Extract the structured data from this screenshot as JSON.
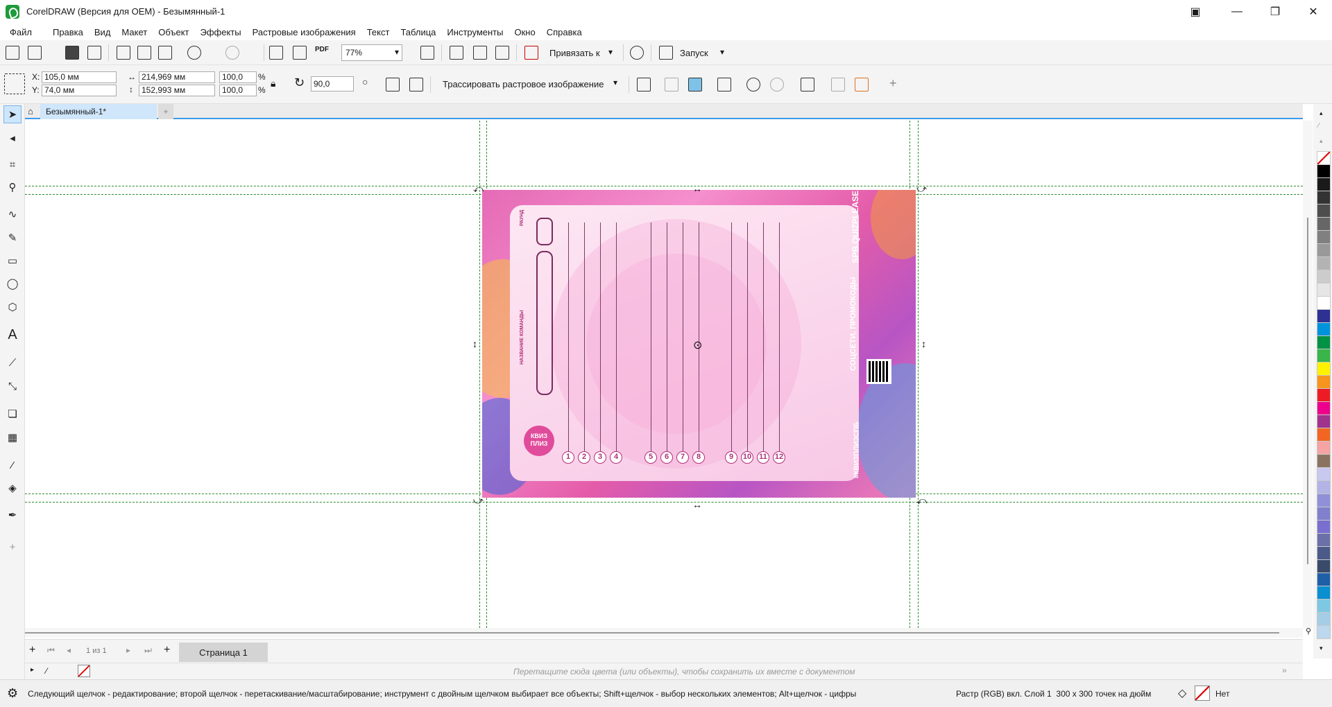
{
  "window": {
    "title": "CorelDRAW (Версия для OEM) - Безымянный-1",
    "controls": [
      "restore-icon",
      "minimize-icon",
      "maximize-icon",
      "close-icon"
    ]
  },
  "menu": [
    "Файл",
    "Правка",
    "Вид",
    "Макет",
    "Объект",
    "Эффекты",
    "Растровые изображения",
    "Текст",
    "Таблица",
    "Инструменты",
    "Окно",
    "Справка"
  ],
  "toolbar": {
    "zoom": "77%",
    "snap_label": "Привязать к",
    "launch_label": "Запуск",
    "pdf_label": "PDF"
  },
  "properties": {
    "x": "105,0 мм",
    "y": "74,0 мм",
    "width": "214,969 мм",
    "height": "152,993 мм",
    "scale_x": "100,0",
    "scale_y": "100,0",
    "percent": "%",
    "rotation": "90,0",
    "trace_label": "Трассировать растровое изображение",
    "x_label": "X:",
    "y_label": "Y:"
  },
  "doc_tab": {
    "name": "Безымянный-1*"
  },
  "card": {
    "round_label": "РАУНД",
    "team_label": "НАЗВАНИЕ КОМАНДЫ",
    "logo": "КВИЗ ПЛИЗ",
    "site": "SPB.QUIZPLEASE.RU",
    "social": "СОЦСЕТИ, ПРОМОКОДЫ",
    "hashtag": "#КВИЗПЛИЗСПБ",
    "numbers": [
      "1",
      "2",
      "3",
      "4",
      "5",
      "6",
      "7",
      "8",
      "9",
      "10",
      "11",
      "12"
    ]
  },
  "page_nav": {
    "counter_prefix": "1",
    "counter_of": "из",
    "counter_total": "1",
    "page_tab": "Страница 1"
  },
  "doc_palette": {
    "hint": "Перетащите сюда цвета (или объекты), чтобы сохранить их вместе с документом"
  },
  "status": {
    "hint": "Следующий щелчок - редактирование; второй щелчок - перетаскивание/масштабирование; инструмент с двойным щелчком выбирает все объекты; Shift+щелчок - выбор нескольких элементов; Alt+щелчок - цифры",
    "info": "Растр (RGB) вкл. Слой 1  300 x 300 точек на дюйм",
    "fill": "Нет"
  },
  "palette_colors": [
    "#ffffff",
    "#000000",
    "#1a1a1a",
    "#333333",
    "#4d4d4d",
    "#666666",
    "#808080",
    "#999999",
    "#b3b3b3",
    "#cccccc",
    "#e6e6e6",
    "#ffffff",
    "#2e3192",
    "#0093dd",
    "#009245",
    "#39b54a",
    "#fff200",
    "#f7941d",
    "#ed1c24",
    "#ec008c",
    "#a0338c",
    "#f26522",
    "#f5a3a3",
    "#8b7260",
    "#c8c8ef",
    "#b3b3e6",
    "#9090d8",
    "#8080cc",
    "#7a6fcf",
    "#6b70a8",
    "#4b5a88",
    "#3a4a6a",
    "#1f5fa8",
    "#0a8fd0",
    "#7ec8e3",
    "#a6cde6",
    "#bdd7ee"
  ]
}
